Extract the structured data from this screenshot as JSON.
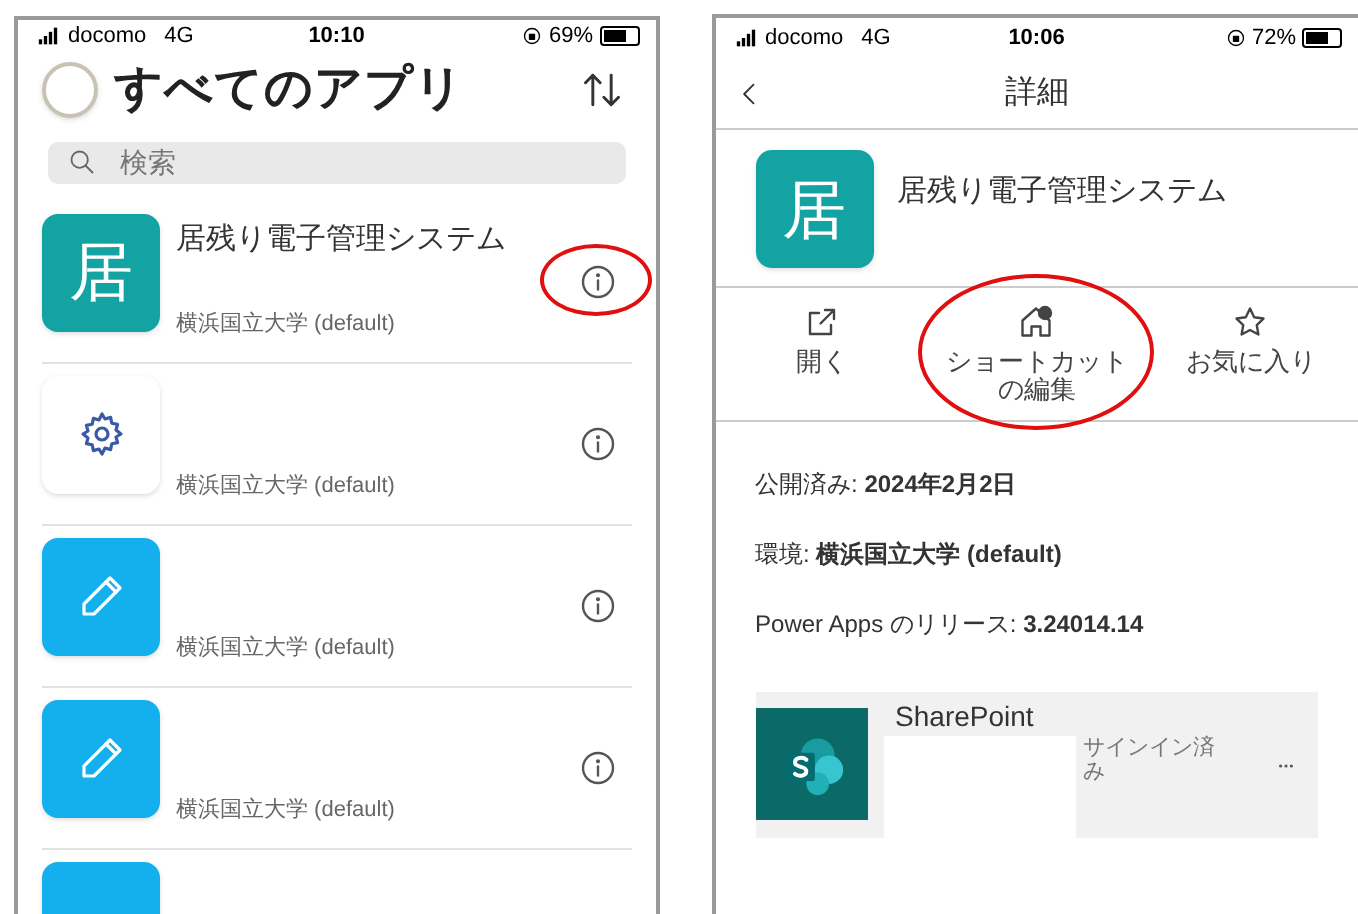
{
  "list_screen": {
    "status_bar": {
      "carrier": "docomo",
      "network": "4G",
      "time": "10:10",
      "battery": "69%"
    },
    "title": "すべてのアプリ",
    "search": {
      "placeholder": "検索"
    },
    "apps": [
      {
        "kind": "letter",
        "glyph": "居",
        "name": "居残り電子管理システム",
        "environment": "横浜国立大学 (default)",
        "highlighted": true
      },
      {
        "kind": "gear",
        "environment": "横浜国立大学 (default)",
        "highlighted": false
      },
      {
        "kind": "pencil",
        "environment": "横浜国立大学 (default)",
        "highlighted": false
      },
      {
        "kind": "pencil",
        "environment": "横浜国立大学 (default)",
        "highlighted": false
      },
      {
        "kind": "blank",
        "highlighted": false
      }
    ]
  },
  "detail_screen": {
    "status_bar": {
      "carrier": "docomo",
      "network": "4G",
      "time": "10:06",
      "battery": "72%"
    },
    "header": "詳細",
    "app": {
      "glyph": "居",
      "name": "居残り電子管理システム"
    },
    "actions": [
      {
        "kind": "open",
        "label": "開く",
        "highlighted": false
      },
      {
        "kind": "shortcut",
        "label_lines": [
          "ショートカット",
          "の編集"
        ],
        "highlighted": true
      },
      {
        "kind": "favorite",
        "label": "お気に入り",
        "highlighted": false
      }
    ],
    "details": [
      {
        "label": "公開済み: ",
        "value": "2024年2月2日"
      },
      {
        "label": "環境: ",
        "value": "横浜国立大学 (default)"
      },
      {
        "label": "Power Apps のリリース: ",
        "value": "3.24014.14"
      }
    ],
    "connection": {
      "name": "SharePoint",
      "status": "サインイン済み"
    }
  }
}
